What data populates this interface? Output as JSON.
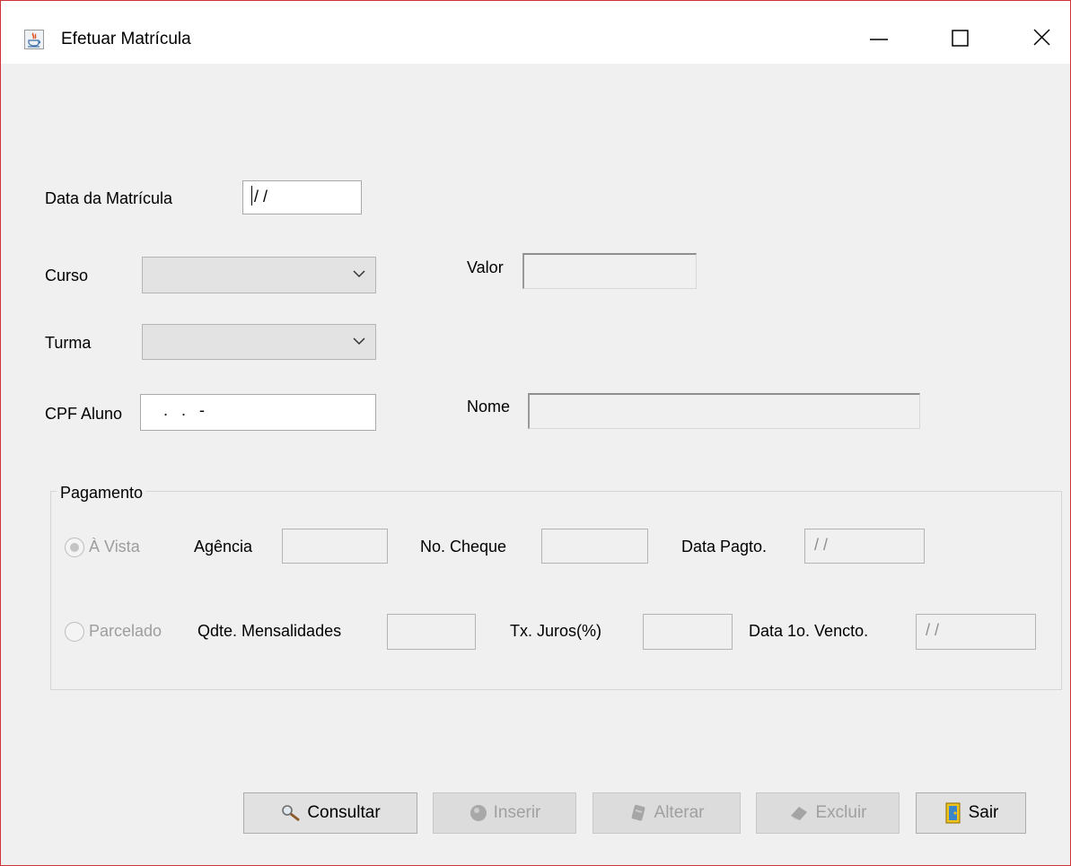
{
  "window": {
    "title": "Efetuar Matrícula"
  },
  "form": {
    "data_label": "Data da Matrícula",
    "data_value": "/ /",
    "curso_label": "Curso",
    "curso_value": "",
    "valor_label": "Valor",
    "valor_value": "",
    "turma_label": "Turma",
    "turma_value": "",
    "cpf_label": "CPF Aluno",
    "cpf_value": "   .   .   -",
    "nome_label": "Nome",
    "nome_value": ""
  },
  "pagamento": {
    "title": "Pagamento",
    "avista_label": "À Vista",
    "agencia_label": "Agência",
    "agencia_value": "",
    "cheque_label": "No. Cheque",
    "cheque_value": "",
    "data_pagto_label": "Data Pagto.",
    "data_pagto_value": "/ /",
    "parcelado_label": "Parcelado",
    "qtde_label": "Qdte. Mensalidades",
    "qtde_value": "",
    "juros_label": "Tx. Juros(%)",
    "juros_value": "",
    "vencto_label": "Data 1o. Vencto.",
    "vencto_value": "/ /"
  },
  "buttons": {
    "consultar": "Consultar",
    "inserir": "Inserir",
    "alterar": "Alterar",
    "excluir": "Excluir",
    "sair": "Sair"
  },
  "colors": {
    "window_border": "#d13438",
    "background": "#f0f0f0"
  }
}
